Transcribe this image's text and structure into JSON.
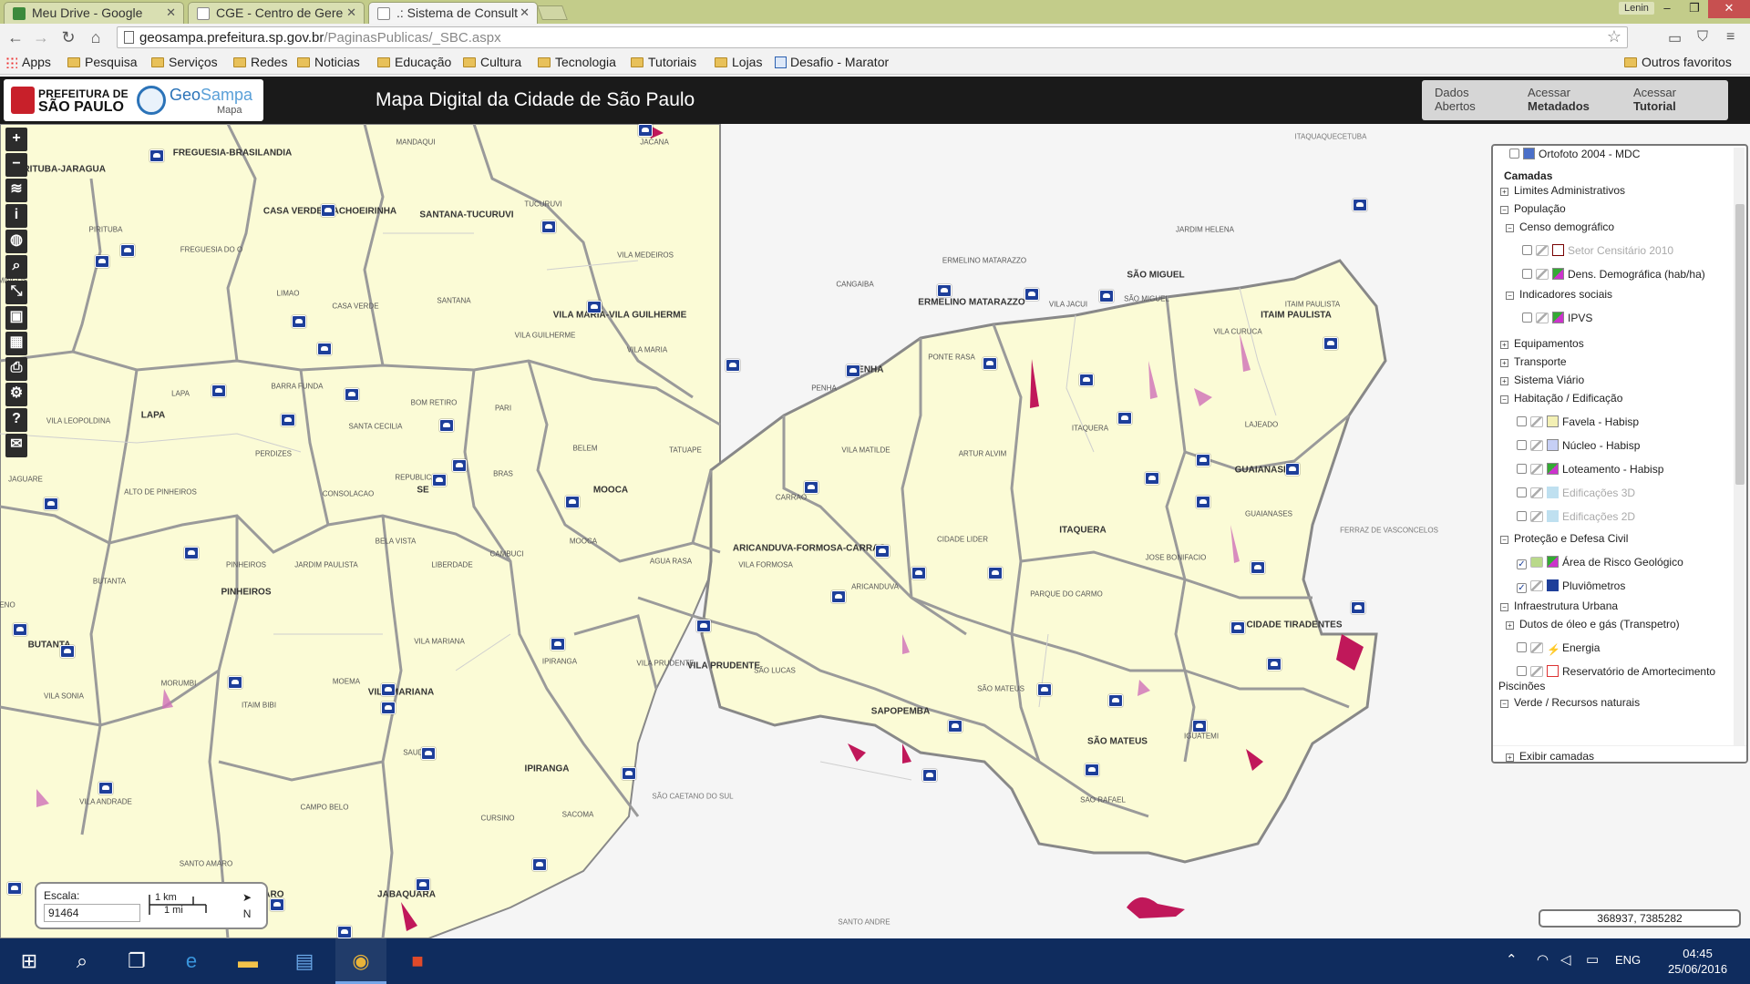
{
  "browser": {
    "tabs": [
      {
        "title": "Meu Drive - Google",
        "active": false
      },
      {
        "title": "CGE - Centro de Gere",
        "active": false
      },
      {
        "title": ".: Sistema de Consult",
        "active": true
      }
    ],
    "user": "Lenin",
    "url_host": "geosampa.prefeitura.sp.gov.br",
    "url_path": "/PaginasPublicas/_SBC.aspx",
    "bookmarks": [
      "Apps",
      "Pesquisa",
      "Serviços",
      "Redes",
      "Noticias",
      "Educação",
      "Cultura",
      "Tecnologia",
      "Tutoriais",
      "Lojas",
      "Desafio - Marator"
    ],
    "other_bookmarks": "Outros favoritos"
  },
  "header": {
    "pref_line1": "PREFEITURA DE",
    "pref_line2": "SÃO PAULO",
    "gs_geo": "Geo",
    "gs_sampa": "Sampa",
    "gs_sub": "Mapa",
    "title": "Mapa Digital da Cidade de São Paulo",
    "btn_dados_1": "Dados",
    "btn_dados_2": "Abertos",
    "btn_meta_1": "Acessar",
    "btn_meta_2": "Metadados",
    "btn_tut_1": "Acessar",
    "btn_tut_2": "Tutorial"
  },
  "map": {
    "labels_big": [
      "FREGUESIA-BRASILANDIA",
      "CASA VERDE-CACHOEIRINHA",
      "SANTANA-TUCURUVI",
      "VILA MARIA-VILA GUILHERME",
      "ERMELINO MATARAZZO",
      "SÃO MIGUEL",
      "ITAIM PAULISTA",
      "LAPA",
      "SE",
      "MOOCA",
      "ARICANDUVA-FORMOSA-CARRAO",
      "ITAQUERA",
      "GUAIANASES",
      "PINHEIROS",
      "BUTANTA",
      "VILA MARIANA",
      "VILA PRUDENTE",
      "CIDADE TIRADENTES",
      "SAPOPEMBA",
      "SÃO MATEUS",
      "IPIRANGA",
      "JABAQUARA",
      "SANTO AMARO",
      "PENHA"
    ],
    "labels_small": [
      "MANDAQUI",
      "JACANA",
      "PIRITUBA",
      "FREGUESIA DO O",
      "TUCURUVI",
      "VILA MEDEIROS",
      "CANGAIBA",
      "ERMELINO MATARAZZO",
      "JARDIM HELENA",
      "ITAIM PAULISTA",
      "VILA JACUI",
      "SÃO MIGUEL",
      "VILA CURUCA",
      "LIMAO",
      "CASA VERDE",
      "SANTANA",
      "VILA GUILHERME",
      "VILA MARIA",
      "PONTE RASA",
      "PENHA",
      "LAJEADO",
      "LAPA",
      "BARRA FUNDA",
      "BOM RETIRO",
      "PARI",
      "SANTA CECILIA",
      "VILA LEOPOLDINA",
      "PERDIZES",
      "BELEM",
      "TATUAPE",
      "VILA MATILDE",
      "ARTUR ALVIM",
      "ITAQUERA",
      "JAGUARE",
      "ALTO DE PINHEIROS",
      "CONSOLACAO",
      "REPUBLICA",
      "BRAS",
      "CARRAO",
      "CIDADE LIDER",
      "GUAIANASES",
      "BELA VISTA",
      "MOOCA",
      "CAMBUCI",
      "LIBERDADE",
      "AGUA RASA",
      "VILA FORMOSA",
      "ARICANDUVA",
      "JOSE BONIFACIO",
      "PARQUE DO CARMO",
      "BUTANTA",
      "PINHEIROS",
      "JARDIM PAULISTA",
      "VILA MARIANA",
      "MORUMBI",
      "MOEMA",
      "IPIRANGA",
      "VILA PRUDENTE",
      "SÃO LUCAS",
      "SÃO MATEUS",
      "IGUATEMI",
      "SAO RAFAEL",
      "VILA SONIA",
      "ITAIM BIBI",
      "SAUDE",
      "CURSINO",
      "SACOMA",
      "VILA ANDRADE",
      "CAMPO BELO",
      "SANTO AMARO",
      "ITAQUAQUECETUBA",
      "FERRAZ DE VASCONCELOS",
      "SÃO CAETANO DO SUL",
      "SANTO ANDRE",
      "PIRITUBA-JARAGUA",
      "MINGOS",
      "ENO"
    ]
  },
  "scale": {
    "label": "Escala:",
    "value": "91464",
    "km": "1 km",
    "mi": "1 mi",
    "north": "N"
  },
  "coords": "368937, 7385282",
  "layers": {
    "top_item": "Ortofoto 2004 - MDC",
    "camadas": "Camadas",
    "limites": "Limites Administrativos",
    "populacao": "População",
    "censo": "Censo demográfico",
    "setor": "Setor Censitário 2010",
    "dens": "Dens. Demográfica (hab/ha)",
    "indicadores": "Indicadores sociais",
    "ipvs": "IPVS",
    "equipamentos": "Equipamentos",
    "transporte": "Transporte",
    "viario": "Sistema Viário",
    "habitacao": "Habitação / Edificação",
    "favela": "Favela - Habisp",
    "nucleo": "Núcleo - Habisp",
    "loteamento": "Loteamento - Habisp",
    "edif3d": "Edificações 3D",
    "edif2d": "Edificações 2D",
    "protecao": "Proteção e Defesa Civil",
    "risco": "Área de Risco Geológico",
    "pluviometros": "Pluviômetros",
    "infra": "Infraestrutura Urbana",
    "dutos": "Dutos de óleo e gás (Transpetro)",
    "energia": "Energia",
    "reservatorio": "Reservatório de Amortecimento",
    "piscinoes": "Piscinões",
    "verde": "Verde / Recursos naturais",
    "exibir": "Exibir camadas"
  },
  "taskbar": {
    "time": "04:45",
    "date": "25/06/2016",
    "lang": "ENG"
  },
  "colors": {
    "map_fill": "#fbfbd6",
    "boundary": "#8c8c8c",
    "pluviometer": "#1e3f9a",
    "risk_area": "#c0185a"
  }
}
